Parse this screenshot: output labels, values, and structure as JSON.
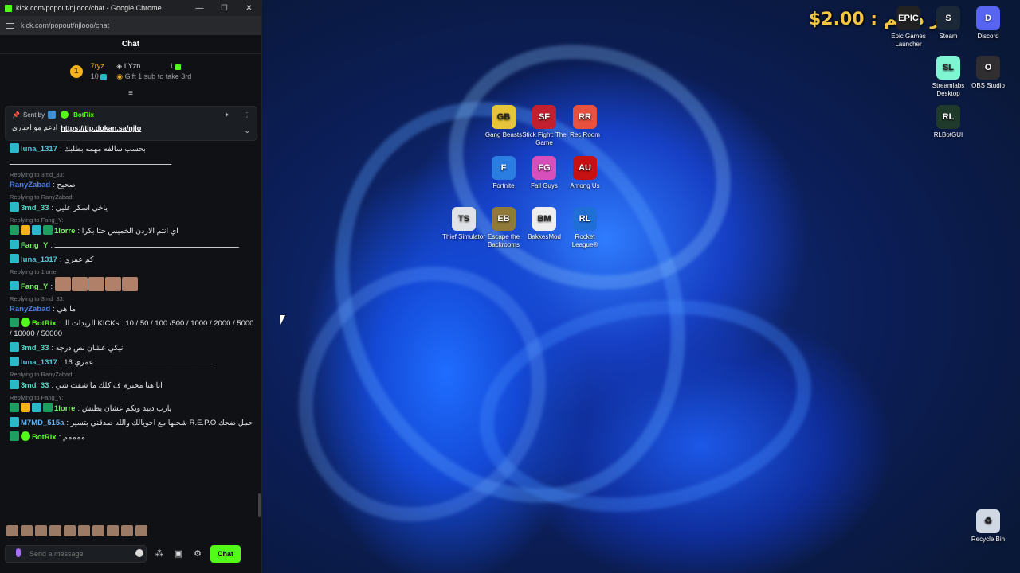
{
  "browser": {
    "title": "kick.com/popout/njlooo/chat - Google Chrome",
    "url": "kick.com/popout/njlooo/chat",
    "controls": [
      "—",
      "☐",
      "✕"
    ]
  },
  "chat": {
    "header": "Chat",
    "leaderboard": {
      "rank1_name": "7ryz",
      "rank1_count": "10",
      "rank2_name": "IIYzn",
      "rank2_count": "1",
      "cta": "Gift 1 sub to take 3rd"
    },
    "pinned": {
      "sent_by_label": "Sent by",
      "sender": "BotRix",
      "text": "ادعم مو اجباري",
      "link": "https://tip.dokan.sa/njlo"
    },
    "messages": [
      {
        "reply": "",
        "user": "luna_1317",
        "text": "بحسب سالفه مهمه بطلبك",
        "color": "u-cyan",
        "badges": [
          "b-sub"
        ]
      },
      {
        "reply": "",
        "user": "",
        "text": "ـــــــــــــــــــــــــــــــــــــــــــــــــــــــــــــــــــــــــ",
        "color": "",
        "badges": []
      },
      {
        "reply": "Replying to 3md_33:",
        "user": "RanyZabad",
        "text": "صحيح",
        "color": "u-blue",
        "badges": []
      },
      {
        "reply": "Replying to RanyZabad:",
        "user": "3md_33",
        "text": "ياخي اسكر عليي",
        "color": "u-teal",
        "badges": [
          "b-sub"
        ]
      },
      {
        "reply": "Replying to Fang_Y:",
        "user": "1lorre",
        "text": "اي انتم الاردن الخميس حتا بكرا",
        "color": "u-lime",
        "badges": [
          "b-kick",
          "b-crown",
          "b-sub",
          "b-kick"
        ]
      },
      {
        "reply": "",
        "user": "Fang_Y",
        "text": "ـــــــــــــــــــــــــــــــــــــــــــــــــــــــــــــــــــــــــــــــــــ",
        "color": "u-lime",
        "badges": [
          "b-sub"
        ]
      },
      {
        "reply": "",
        "user": "luna_1317",
        "text": "كم عمري",
        "color": "u-cyan",
        "badges": [
          "b-sub"
        ]
      },
      {
        "reply": "Replying to 1lorre:",
        "user": "Fang_Y",
        "text": "",
        "color": "u-lime",
        "badges": [
          "b-sub"
        ]
      },
      {
        "reply": "Replying to 3md_33:",
        "user": "RanyZabad",
        "text": "ما هي",
        "color": "u-blue",
        "badges": []
      },
      {
        "reply": "",
        "user": "BotRix",
        "text": "الريدات الـ KICKs : 10 / 50 / 100 /500 / 1000 / 2000 / 5000 / 10000 / 50000",
        "color": "u-green",
        "badges": [
          "b-kick",
          "b-verified"
        ]
      },
      {
        "reply": "",
        "user": "3md_33",
        "text": "نيكي عشان نص درجه",
        "color": "u-teal",
        "badges": [
          "b-sub"
        ]
      },
      {
        "reply": "",
        "user": "luna_1317",
        "text": "ـــــــــــــــــــــــــــــــــــــــــــــــــــــ عمري 16",
        "color": "u-cyan",
        "badges": [
          "b-sub"
        ]
      },
      {
        "reply": "Replying to RanyZabad:",
        "user": "3md_33",
        "text": "انا هنا محترم ف كلك ما شفت شي",
        "color": "u-teal",
        "badges": [
          "b-sub"
        ]
      },
      {
        "reply": "Replying to Fang_Y:",
        "user": "1lorre",
        "text": "يارب دبيد ويكم عشان بطنش",
        "color": "u-lime",
        "badges": [
          "b-kick",
          "b-crown",
          "b-sub",
          "b-kick"
        ]
      },
      {
        "reply": "",
        "user": "M7MD_515a",
        "text": "شحبها مع اخويالك والله صدقني بتسير R.E.P.O حمل ضحك",
        "color": "u-sky",
        "badges": [
          "b-sub"
        ]
      },
      {
        "reply": "",
        "user": "BotRix",
        "text": "ممممم",
        "color": "u-green",
        "badges": [
          "b-kick",
          "b-verified"
        ]
      }
    ],
    "composer": {
      "placeholder": "Send a message",
      "send_label": "Chat"
    }
  },
  "overlay": {
    "amount_text": "$2.00 : اخر داعم"
  },
  "desktop_icons": [
    {
      "label": "Epic Games Launcher",
      "color": "#222",
      "glyph": "EPIC"
    },
    {
      "label": "Steam",
      "color": "#1b2838",
      "glyph": "S"
    },
    {
      "label": "Discord",
      "color": "#5865f2",
      "glyph": "D"
    },
    {
      "label": "Streamlabs Desktop",
      "color": "#80f5d2",
      "glyph": "SL"
    },
    {
      "label": "OBS Studio",
      "color": "#302e31",
      "glyph": "O"
    },
    {
      "label": "RLBotGUI",
      "color": "#1f3a2a",
      "glyph": "RL"
    },
    {
      "label": "Gang Beasts",
      "color": "#e6c53a",
      "glyph": "GB"
    },
    {
      "label": "Stick Fight: The Game",
      "color": "#c2202e",
      "glyph": "SF"
    },
    {
      "label": "Rec Room",
      "color": "#e8513e",
      "glyph": "RR"
    },
    {
      "label": "Fortnite",
      "color": "#2a7de1",
      "glyph": "F"
    },
    {
      "label": "Fall Guys",
      "color": "#d64fbb",
      "glyph": "FG"
    },
    {
      "label": "Among Us",
      "color": "#c51111",
      "glyph": "AU"
    },
    {
      "label": "Thief Simulator",
      "color": "#dfe3e8",
      "glyph": "TS"
    },
    {
      "label": "Escape the Backrooms",
      "color": "#8f7a3a",
      "glyph": "EB"
    },
    {
      "label": "BakkesMod",
      "color": "#eeeeee",
      "glyph": "BM"
    },
    {
      "label": "Rocket League®",
      "color": "#1f6fd6",
      "glyph": "RL"
    },
    {
      "label": "Recycle Bin",
      "color": "#cfd8e3",
      "glyph": "♻"
    }
  ]
}
